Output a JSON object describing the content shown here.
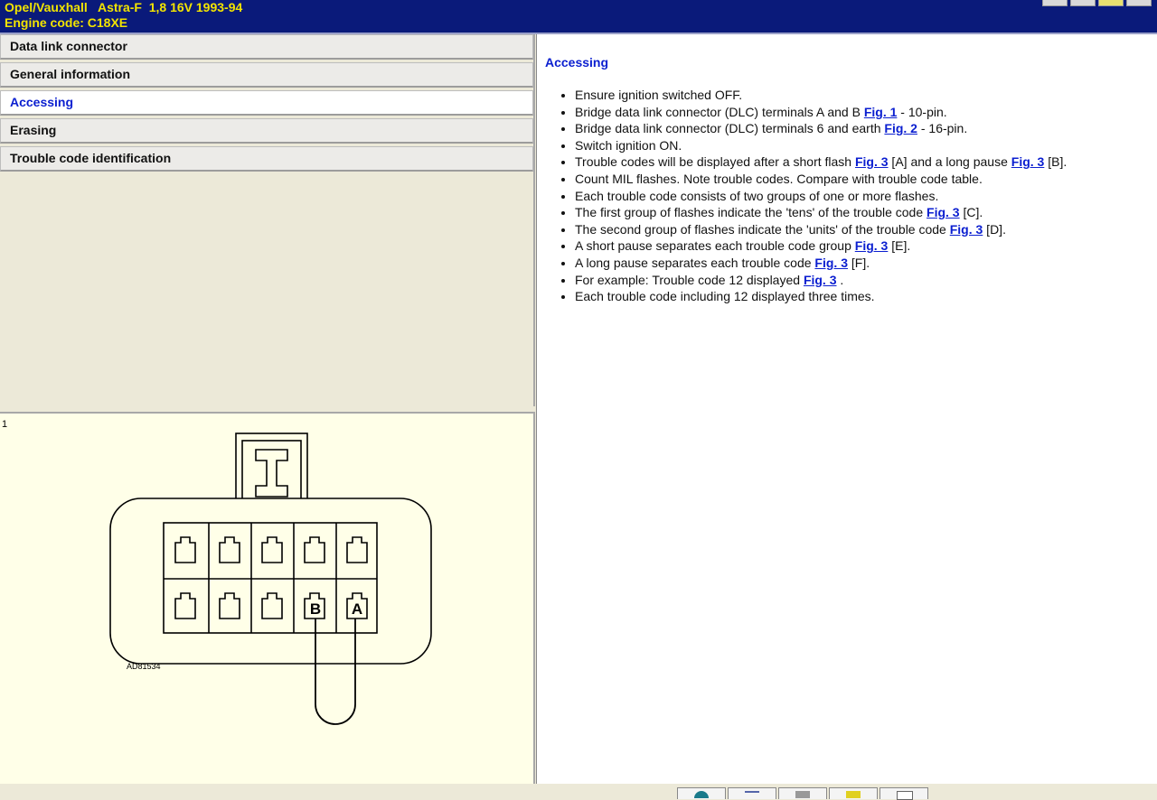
{
  "header": {
    "vehicle_line": "Opel/Vauxhall   Astra-F  1,8 16V 1993-94",
    "engine_line": "Engine code: C18XE"
  },
  "nav": {
    "items": [
      {
        "label": "Data link connector"
      },
      {
        "label": "General information"
      },
      {
        "label": "Accessing",
        "active": true
      },
      {
        "label": "Erasing"
      },
      {
        "label": "Trouble code identification"
      }
    ]
  },
  "figure": {
    "number": "1",
    "code": "AD81534",
    "pin_b": "B",
    "pin_a": "A"
  },
  "content": {
    "title": "Accessing",
    "items": [
      {
        "pre": "Ensure ignition switched OFF.",
        "link": "",
        "post": ""
      },
      {
        "pre": "Bridge data link connector (DLC) terminals A and B ",
        "link": "Fig. 1",
        "post": " - 10-pin."
      },
      {
        "pre": "Bridge data link connector (DLC) terminals 6 and earth ",
        "link": "Fig. 2",
        "post": " - 16-pin."
      },
      {
        "pre": "Switch ignition ON.",
        "link": "",
        "post": ""
      },
      {
        "pre": "Trouble codes will be displayed after a short flash ",
        "link": "Fig. 3",
        "post": " [A] and a long pause ",
        "link2": "Fig. 3",
        "post2": " [B]."
      },
      {
        "pre": "Count MIL flashes. Note trouble codes. Compare with trouble code table.",
        "link": "",
        "post": ""
      },
      {
        "pre": "Each trouble code consists of two groups of one or more flashes.",
        "link": "",
        "post": ""
      },
      {
        "pre": "The first group of flashes indicate the 'tens' of the trouble code ",
        "link": "Fig. 3",
        "post": " [C]."
      },
      {
        "pre": "The second group of flashes indicate the 'units' of the trouble code ",
        "link": "Fig. 3",
        "post": " [D]."
      },
      {
        "pre": "A short pause separates each trouble code group ",
        "link": "Fig. 3",
        "post": " [E]."
      },
      {
        "pre": "A long pause separates each trouble code ",
        "link": "Fig. 3",
        "post": " [F]."
      },
      {
        "pre": "For example: Trouble code 12 displayed ",
        "link": "Fig. 3",
        "post": " ."
      },
      {
        "pre": "Each trouble code including 12 displayed three times.",
        "link": "",
        "post": ""
      }
    ]
  },
  "toolbar": {
    "buttons": [
      {
        "icon": "globe-icon"
      },
      {
        "icon": "pencil-icon"
      },
      {
        "icon": "print-icon"
      },
      {
        "icon": "folder-icon"
      },
      {
        "icon": "page-icon"
      }
    ]
  }
}
